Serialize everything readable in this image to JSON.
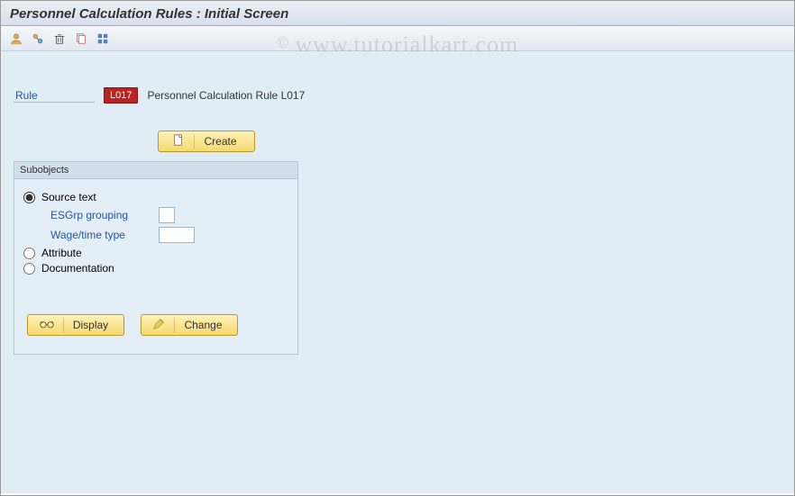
{
  "title": "Personnel Calculation Rules : Initial Screen",
  "toolbar_icons": [
    "person-icon",
    "copy-link-icon",
    "trash-icon",
    "clipboard-icon",
    "grid-icon"
  ],
  "watermark": "www.tutorialkart.com",
  "rule": {
    "label": "Rule",
    "code": "L017",
    "desc": "Personnel Calculation Rule  L017"
  },
  "buttons": {
    "create": "Create",
    "display": "Display",
    "change": "Change"
  },
  "subobjects": {
    "title": "Subobjects",
    "options": {
      "source_text": "Source text",
      "attribute": "Attribute",
      "documentation": "Documentation"
    },
    "selected": "source_text",
    "sub_fields": {
      "esgrp": {
        "label": "ESGrp grouping",
        "value": ""
      },
      "wage": {
        "label": "Wage/time type",
        "value": ""
      }
    }
  }
}
